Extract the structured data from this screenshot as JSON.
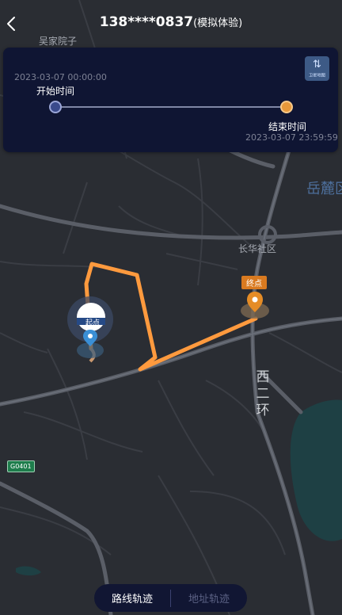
{
  "header": {
    "title_main": "138****0837",
    "title_suffix": "(模拟体验)"
  },
  "time_range": {
    "start_date": "2023-03-07 00:00:00",
    "start_label": "开始时间",
    "end_label": "结束时间",
    "end_date": "2023-03-07 23:59:59",
    "switch_caption": "卫星地图"
  },
  "map": {
    "labels": {
      "village": "吴家院子",
      "district": "长华社区",
      "mountain": "岳麓区",
      "ring_road": "西二环",
      "highway_code": "G0401"
    },
    "start_marker_label": "起点",
    "end_marker_label": "终点"
  },
  "tabs": [
    {
      "label": "路线轨迹",
      "active": true
    },
    {
      "label": "地址轨迹",
      "active": false
    }
  ],
  "colors": {
    "route": "#ff9a3e",
    "panel": "#0f1533",
    "start_pin": "#3a8fd6",
    "end_pin": "#e58c26"
  },
  "icons": {
    "back": "chevron-left-icon",
    "map_switch": "satellite-map-icon",
    "start_pin": "start-pin-icon",
    "end_pin": "end-pin-icon"
  }
}
